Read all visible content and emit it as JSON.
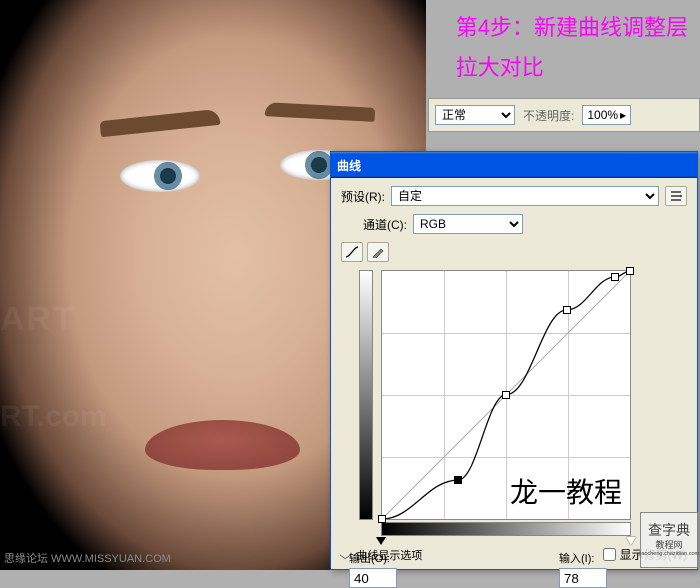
{
  "canvas": {
    "watermark_bl": "思缘论坛  WWW.MISSYUAN.COM",
    "watermark_art": "ART",
    "watermark_art2": "RT.com"
  },
  "annot": {
    "line1": "第4步：新建曲线调整层",
    "line2": "拉大对比"
  },
  "layers_panel": {
    "blend_mode": "正常",
    "opacity_label": "不透明度:",
    "opacity_value": "100%"
  },
  "curves": {
    "title": "曲线",
    "preset_label": "预设(R):",
    "preset_value": "自定",
    "channel_label": "通道(C):",
    "channel_value": "RGB",
    "output_label": "输出(O):",
    "output_value": "40",
    "input_label": "输入(I):",
    "input_value": "78",
    "showclip_label": "显示修剪(W)",
    "displayopts_label": "曲线显示选项",
    "graph_watermark": "龙一教程"
  },
  "chart_data": {
    "type": "line",
    "title": "Curves",
    "xlabel": "Input",
    "ylabel": "Output",
    "xlim": [
      0,
      255
    ],
    "ylim": [
      0,
      255
    ],
    "grid": 4,
    "reference_line": "identity",
    "series": [
      {
        "name": "RGB",
        "points": [
          {
            "x": 0,
            "y": 0
          },
          {
            "x": 78,
            "y": 40,
            "selected": true
          },
          {
            "x": 128,
            "y": 128
          },
          {
            "x": 190,
            "y": 215
          },
          {
            "x": 240,
            "y": 249
          },
          {
            "x": 255,
            "y": 255
          }
        ]
      }
    ]
  },
  "site_wm": {
    "cn": "查字典",
    "py": "jiaocheng.chazidian.com",
    "sub": "教程网"
  }
}
